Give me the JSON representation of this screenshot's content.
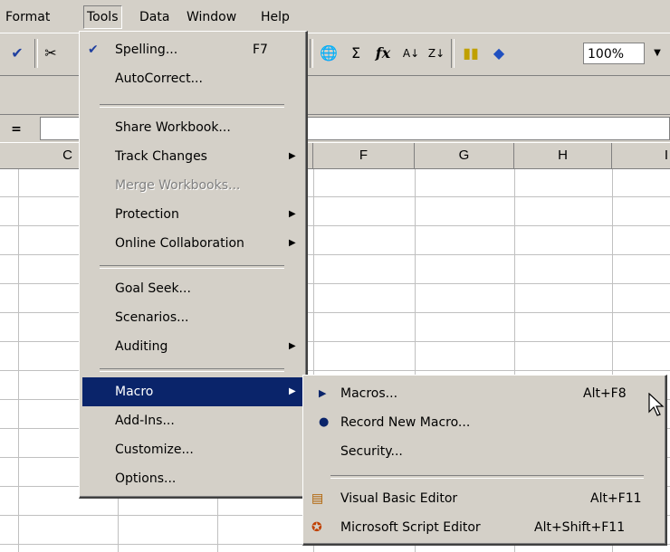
{
  "menubar": {
    "items": [
      "Format",
      "Tools",
      "Data",
      "Window",
      "Help"
    ]
  },
  "toolbar": {
    "zoom": "100%",
    "sum_symbol": "Σ",
    "fx_symbol": "fx"
  },
  "formula_bar": {
    "equals": "="
  },
  "columns": [
    "C",
    "F",
    "G",
    "H",
    "I"
  ],
  "tools_menu": {
    "items": [
      {
        "label": "Spelling...",
        "shortcut": "F7"
      },
      {
        "label": "AutoCorrect..."
      },
      {
        "label": "Share Workbook..."
      },
      {
        "label": "Track Changes"
      },
      {
        "label": "Merge Workbooks..."
      },
      {
        "label": "Protection"
      },
      {
        "label": "Online Collaboration"
      },
      {
        "label": "Goal Seek..."
      },
      {
        "label": "Scenarios..."
      },
      {
        "label": "Auditing"
      },
      {
        "label": "Macro"
      },
      {
        "label": "Add-Ins..."
      },
      {
        "label": "Customize..."
      },
      {
        "label": "Options..."
      }
    ]
  },
  "macro_submenu": {
    "items": [
      {
        "label": "Macros...",
        "shortcut": "Alt+F8"
      },
      {
        "label": "Record New Macro..."
      },
      {
        "label": "Security..."
      },
      {
        "label": "Visual Basic Editor",
        "shortcut": "Alt+F11"
      },
      {
        "label": "Microsoft Script Editor",
        "shortcut": "Alt+Shift+F11"
      }
    ]
  },
  "colors": {
    "menu_bg": "#d4d0c8",
    "highlight": "#0a246a"
  }
}
